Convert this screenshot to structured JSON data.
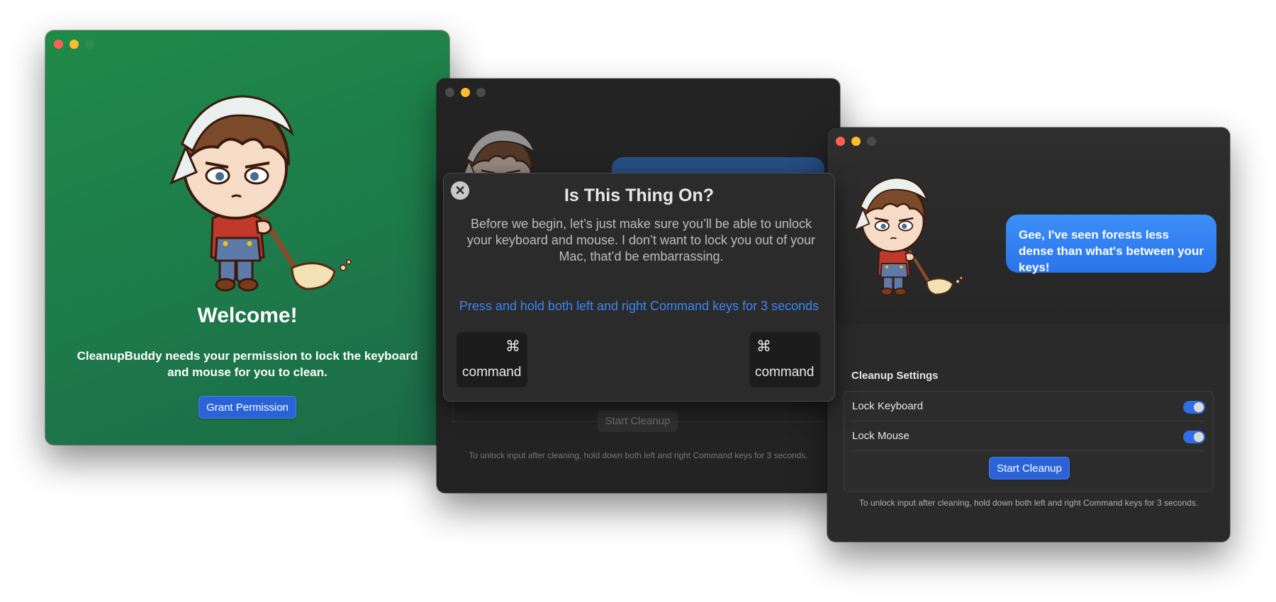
{
  "welcome_window": {
    "title": "Welcome!",
    "message": "CleanupBuddy needs your permission to lock the keyboard and mouse for you to clean.",
    "grant_button": "Grant Permission"
  },
  "check_window": {
    "start_button": "Start Cleanup",
    "footnote": "To unlock input after cleaning, hold down both left and right Command keys for 3 seconds."
  },
  "dialog": {
    "title": "Is This Thing On?",
    "body": "Before we begin, let’s just make sure you’ll be able to unlock your keyboard and mouse. I don’t want to lock you out of your Mac, that’d be embarrassing.",
    "hint": "Press and hold both left and right Command keys for 3 seconds",
    "keys": [
      {
        "symbol": "⌘",
        "label": "command"
      },
      {
        "symbol": "⌘",
        "label": "command"
      }
    ]
  },
  "cleanup_window": {
    "speech_bubble": "Gee, I've seen forests less dense than what's between your keys!",
    "settings_title": "Cleanup Settings",
    "settings": [
      {
        "label": "Lock Keyboard",
        "enabled": true
      },
      {
        "label": "Lock Mouse",
        "enabled": true
      }
    ],
    "start_button": "Start Cleanup",
    "footnote": "To unlock input after cleaning, hold down both left and right Command keys for 3 seconds."
  },
  "colors": {
    "welcome_bg": "#1f8a48",
    "accent_blue": "#2a63d8",
    "hint_blue": "#3d84f5",
    "bubble_blue": "#3d8ff8",
    "dark_bg": "#2a2a2a"
  }
}
